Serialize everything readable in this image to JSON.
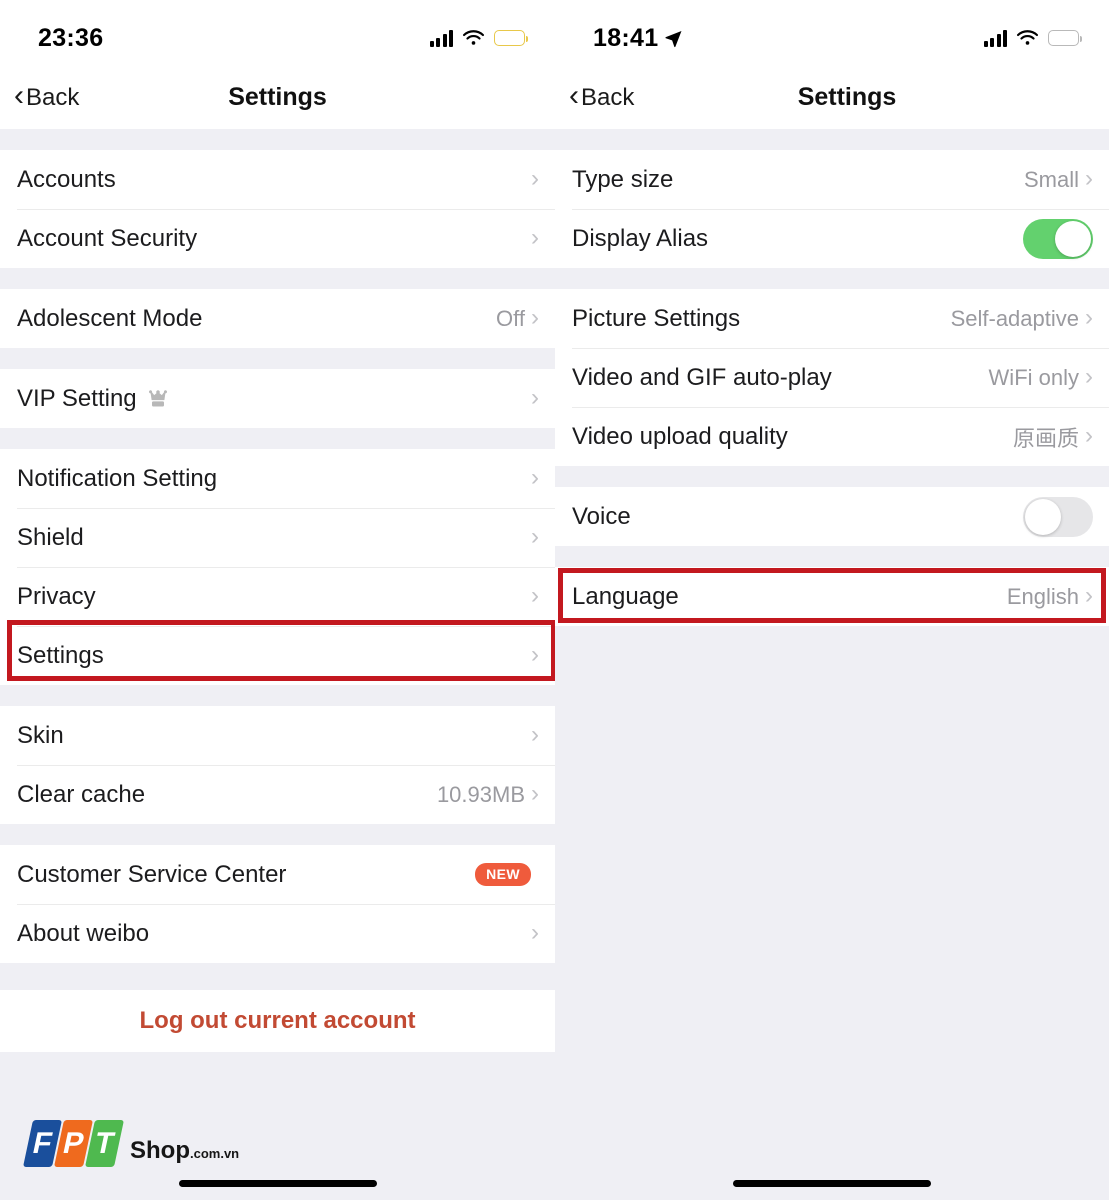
{
  "left": {
    "status": {
      "time": "23:36",
      "signal_icon": "cellular-signal-icon",
      "wifi_icon": "wifi-icon",
      "battery_icon": "battery-low-power-icon",
      "battery_level_pct": 20,
      "battery_color": "#f5cd3a"
    },
    "nav": {
      "back_label": "Back",
      "title": "Settings",
      "back_icon": "chevron-left-icon"
    },
    "groups": [
      {
        "rows": [
          {
            "label": "Accounts",
            "value": "",
            "accessory": "chevron"
          },
          {
            "label": "Account Security",
            "value": "",
            "accessory": "chevron"
          }
        ]
      },
      {
        "rows": [
          {
            "label": "Adolescent Mode",
            "value": "Off",
            "accessory": "chevron"
          }
        ]
      },
      {
        "rows": [
          {
            "label": "VIP Setting",
            "value": "",
            "accessory": "chevron",
            "icon": "crown-icon"
          }
        ]
      },
      {
        "rows": [
          {
            "label": "Notification Setting",
            "value": "",
            "accessory": "chevron"
          },
          {
            "label": "Shield",
            "value": "",
            "accessory": "chevron"
          },
          {
            "label": "Privacy",
            "value": "",
            "accessory": "chevron"
          },
          {
            "label": "Settings",
            "value": "",
            "accessory": "chevron",
            "highlighted": true
          }
        ]
      },
      {
        "rows": [
          {
            "label": "Skin",
            "value": "",
            "accessory": "chevron"
          },
          {
            "label": "Clear cache",
            "value": "10.93MB",
            "accessory": "chevron"
          }
        ]
      },
      {
        "rows": [
          {
            "label": "Customer Service Center",
            "value": "",
            "accessory": "badge",
            "badge": "NEW"
          },
          {
            "label": "About weibo",
            "value": "",
            "accessory": "chevron"
          }
        ]
      }
    ],
    "logout_label": "Log out current account",
    "highlight_color": "#c3181f",
    "badge_color": "#ef5b3c",
    "logout_color": "#c24a33"
  },
  "right": {
    "status": {
      "time": "18:41",
      "location_icon": "location-arrow-icon",
      "signal_icon": "cellular-signal-icon",
      "wifi_icon": "wifi-icon",
      "battery_icon": "battery-icon",
      "battery_level_pct": 55,
      "battery_color": "#000000"
    },
    "nav": {
      "back_label": "Back",
      "title": "Settings",
      "back_icon": "chevron-left-icon"
    },
    "groups": [
      {
        "rows": [
          {
            "label": "Type size",
            "value": "Small",
            "accessory": "chevron"
          },
          {
            "label": "Display Alias",
            "value": "",
            "accessory": "toggle",
            "toggle_on": true
          }
        ]
      },
      {
        "rows": [
          {
            "label": "Picture Settings",
            "value": "Self-adaptive",
            "accessory": "chevron"
          },
          {
            "label": "Video and GIF auto-play",
            "value": "WiFi only",
            "accessory": "chevron"
          },
          {
            "label": "Video upload quality",
            "value": "原画质",
            "accessory": "chevron"
          }
        ]
      },
      {
        "rows": [
          {
            "label": "Voice",
            "value": "",
            "accessory": "toggle",
            "toggle_on": false
          }
        ]
      },
      {
        "rows": [
          {
            "label": "Language",
            "value": "English",
            "accessory": "chevron",
            "highlighted": true
          }
        ]
      }
    ],
    "toggle_on_color": "#63d16e",
    "toggle_off_color": "#e6e6e8"
  },
  "watermark": {
    "letters": [
      "F",
      "P",
      "T"
    ],
    "shop_text": "Shop",
    "domain_text": ".com.vn",
    "colors": {
      "f": "#1a4f9c",
      "p": "#ef6a1e",
      "t": "#4fb94f"
    }
  }
}
